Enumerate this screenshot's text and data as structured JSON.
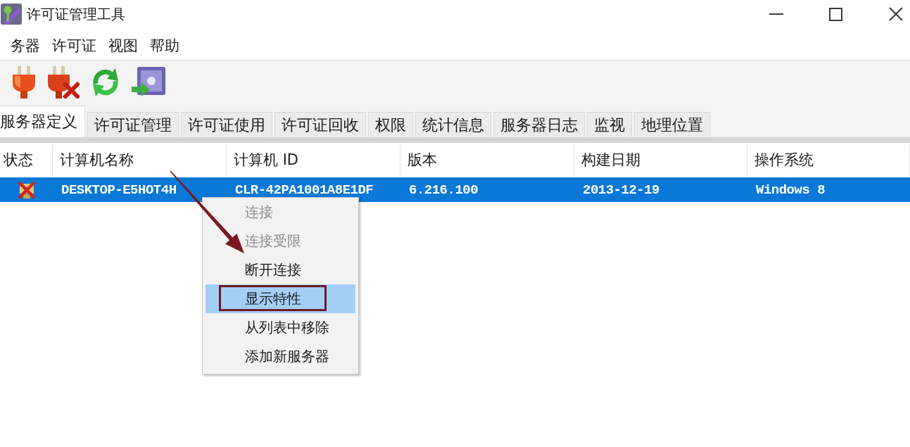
{
  "window": {
    "title": "许可证管理工具"
  },
  "menu_bar": [
    "务器",
    "许可证",
    "视图",
    "帮助"
  ],
  "tabs": [
    {
      "label": "服务器定义",
      "selected": true
    },
    {
      "label": "许可证管理",
      "selected": false
    },
    {
      "label": "许可证使用",
      "selected": false
    },
    {
      "label": "许可证回收",
      "selected": false
    },
    {
      "label": "权限",
      "selected": false
    },
    {
      "label": "统计信息",
      "selected": false
    },
    {
      "label": "服务器日志",
      "selected": false
    },
    {
      "label": "监视",
      "selected": false
    },
    {
      "label": "地理位置",
      "selected": false
    }
  ],
  "table": {
    "columns": [
      "状态",
      "计算机名称",
      "计算机 ID",
      "版本",
      "构建日期",
      "操作系统"
    ],
    "rows": [
      {
        "kind": "error",
        "selected": true,
        "cells": [
          "",
          "DESKTOP-E5HOT4H",
          "CLR-42PA1001A8E1DF",
          "6.216.100",
          "2013-12-19",
          "Windows 8"
        ]
      }
    ]
  },
  "context_menu": {
    "items": [
      {
        "label": "连接",
        "disabled": true,
        "selected": false,
        "outlined": false
      },
      {
        "label": "连接受限",
        "disabled": true,
        "selected": false,
        "outlined": false
      },
      {
        "label": "断开连接",
        "disabled": false,
        "selected": false,
        "outlined": false
      },
      {
        "label": "显示特性",
        "disabled": false,
        "selected": true,
        "outlined": true
      },
      {
        "label": "从列表中移除",
        "disabled": false,
        "selected": false,
        "outlined": false
      },
      {
        "label": "添加新服务器",
        "disabled": false,
        "selected": false,
        "outlined": false
      }
    ]
  }
}
